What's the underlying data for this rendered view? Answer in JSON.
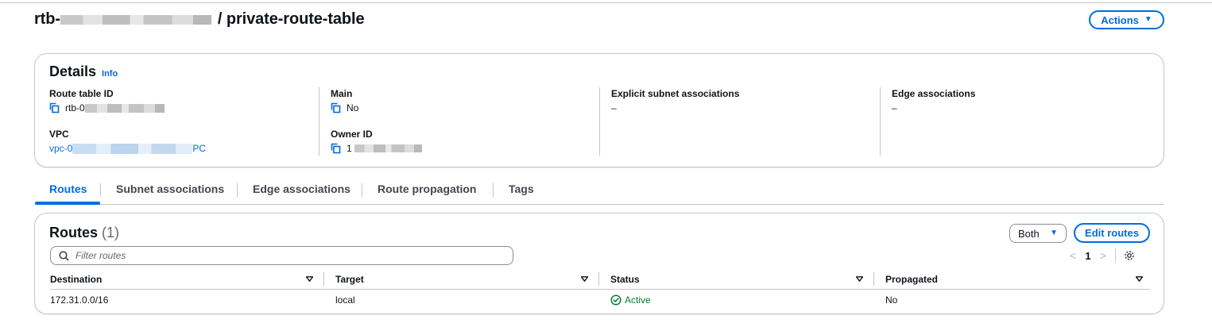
{
  "header": {
    "title_prefix": "rtb-",
    "title_suffix": "/ private-route-table",
    "actions_label": "Actions"
  },
  "details": {
    "title": "Details",
    "info": "Info",
    "route_table_id_label": "Route table ID",
    "route_table_id_value": "rtb-0",
    "vpc_label": "VPC",
    "vpc_value_prefix": "vpc-0",
    "vpc_value_suffix": "PC",
    "main_label": "Main",
    "main_value": "No",
    "owner_id_label": "Owner ID",
    "owner_id_value": "1",
    "explicit_label": "Explicit subnet associations",
    "explicit_value": "–",
    "edge_label": "Edge associations",
    "edge_value": "–"
  },
  "tabs": [
    {
      "label": "Routes",
      "active": true
    },
    {
      "label": "Subnet associations",
      "active": false
    },
    {
      "label": "Edge associations",
      "active": false
    },
    {
      "label": "Route propagation",
      "active": false
    },
    {
      "label": "Tags",
      "active": false
    }
  ],
  "routes": {
    "title": "Routes",
    "count": "(1)",
    "filter_placeholder": "Filter routes",
    "both_label": "Both",
    "edit_label": "Edit routes",
    "page": "1",
    "columns": [
      "Destination",
      "Target",
      "Status",
      "Propagated"
    ],
    "rows": [
      {
        "destination": "172.31.0.0/16",
        "target": "local",
        "status": "Active",
        "propagated": "No"
      }
    ]
  },
  "colors": {
    "link": "#006ce0",
    "success": "#00802f",
    "border": "#c6c6cd"
  },
  "icons": [
    "copy-icon",
    "search-icon",
    "settings-gear-icon",
    "sort-icon",
    "status-check-icon",
    "chevron-left-icon",
    "chevron-right-icon",
    "caret-down-icon"
  ]
}
